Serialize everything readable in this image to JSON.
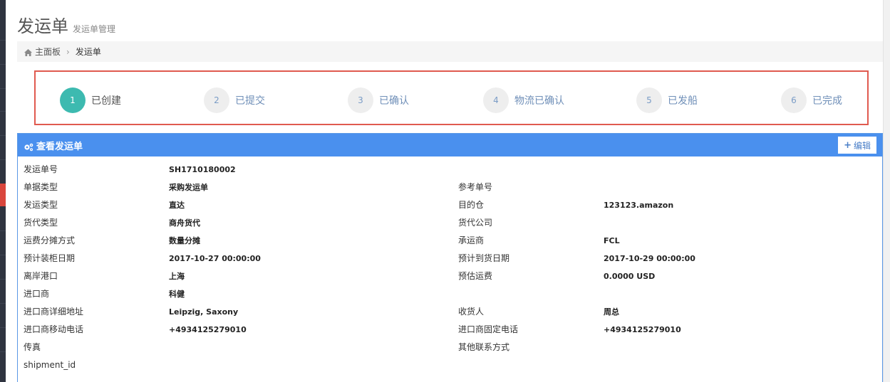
{
  "header": {
    "title": "发运单",
    "subtitle": "发运单管理"
  },
  "breadcrumb": {
    "home": "主面板",
    "current": "发运单"
  },
  "steps": [
    {
      "num": "1",
      "label": "已创建",
      "active": true
    },
    {
      "num": "2",
      "label": "已提交",
      "active": false
    },
    {
      "num": "3",
      "label": "已确认",
      "active": false
    },
    {
      "num": "4",
      "label": "物流已确认",
      "active": false
    },
    {
      "num": "5",
      "label": "已发船",
      "active": false
    },
    {
      "num": "6",
      "label": "已完成",
      "active": false
    }
  ],
  "panel": {
    "title": "查看发运单",
    "edit_label": "编辑"
  },
  "fields": [
    {
      "k1": "发运单号",
      "v1": "SH1710180002",
      "k2": "",
      "v2": ""
    },
    {
      "k1": "单据类型",
      "v1": "采购发运单",
      "k2": "参考单号",
      "v2": ""
    },
    {
      "k1": "发运类型",
      "v1": "直达",
      "k2": "目的仓",
      "v2": "123123.amazon"
    },
    {
      "k1": "货代类型",
      "v1": "商舟货代",
      "k2": "货代公司",
      "v2": ""
    },
    {
      "k1": "运费分摊方式",
      "v1": "数量分摊",
      "k2": "承运商",
      "v2": "FCL"
    },
    {
      "k1": "预计装柜日期",
      "v1": "2017-10-27 00:00:00",
      "k2": "预计到货日期",
      "v2": "2017-10-29 00:00:00"
    },
    {
      "k1": "离岸港口",
      "v1": "上海",
      "k2": "预估运费",
      "v2": "0.0000 USD"
    },
    {
      "k1": "进口商",
      "v1": "科健",
      "k2": "",
      "v2": ""
    },
    {
      "k1": "进口商详细地址",
      "v1": "Leipzig, Saxony",
      "k2": "收货人",
      "v2": "周总"
    },
    {
      "k1": "进口商移动电话",
      "v1": "+4934125279010",
      "k2": "进口商固定电话",
      "v2": "+4934125279010"
    },
    {
      "k1": "传真",
      "v1": "",
      "k2": "其他联系方式",
      "v2": ""
    },
    {
      "k1": "shipment_id",
      "v1": "",
      "k2": "",
      "v2": ""
    }
  ],
  "colors": {
    "primary": "#4a90ee",
    "step_active": "#3dbab0",
    "highlight_border": "#e05a4f"
  }
}
